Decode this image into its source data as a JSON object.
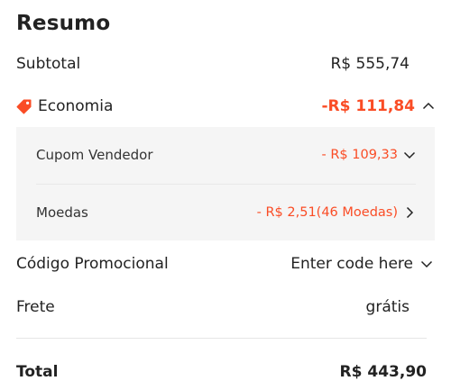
{
  "summary": {
    "title": "Resumo",
    "subtotal": {
      "label": "Subtotal",
      "value": "R$ 555,74"
    },
    "economia": {
      "label": "Economia",
      "value": "-R$ 111,84",
      "icon": "tag-icon"
    },
    "discounts": [
      {
        "label": "Cupom Vendedor",
        "value": "- R$ 109,33",
        "icon": "chevron-down-icon"
      },
      {
        "label": "Moedas",
        "value": "- R$ 2,51(46 Moedas)",
        "icon": "chevron-right-icon"
      }
    ],
    "promo": {
      "label": "Código Promocional",
      "value": "Enter code here",
      "icon": "chevron-down-icon"
    },
    "frete": {
      "label": "Frete",
      "value": "grátis"
    },
    "total": {
      "label": "Total",
      "value": "R$ 443,90"
    }
  },
  "colors": {
    "accent": "#fa4c25",
    "panel_bg": "#f5f5f5",
    "text": "#222222"
  }
}
